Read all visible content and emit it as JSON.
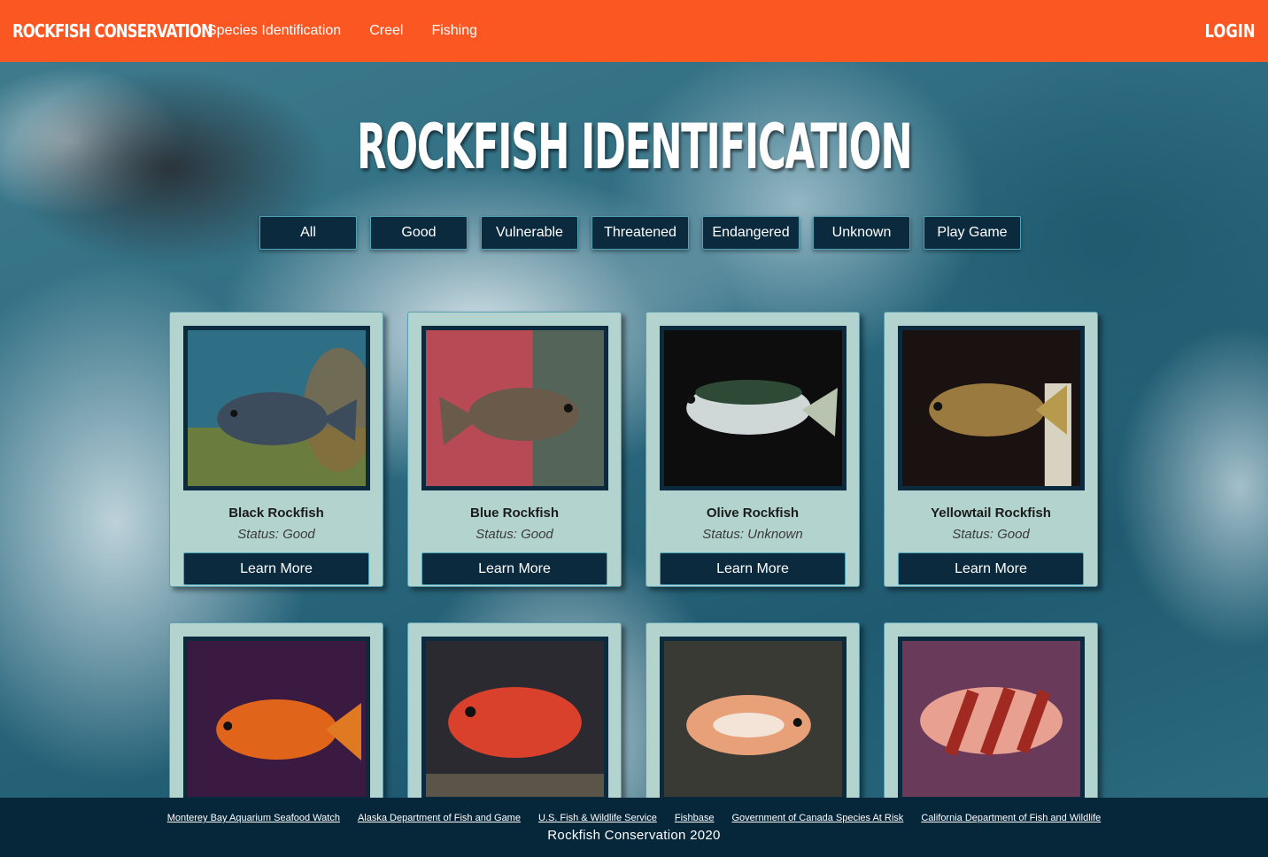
{
  "navbar": {
    "brand": "ROCKFISH CONSERVATION",
    "links": [
      "Species Identification",
      "Creel",
      "Fishing"
    ],
    "login": "LOGIN"
  },
  "page_title": "ROCKFISH IDENTIFICATION",
  "filters": [
    "All",
    "Good",
    "Vulnerable",
    "Threatened",
    "Endangered",
    "Unknown",
    "Play Game"
  ],
  "cards": [
    {
      "name": "Black Rockfish",
      "status": "Status: Good",
      "button": "Learn More",
      "photo_icon": "black-rockfish-photo"
    },
    {
      "name": "Blue Rockfish",
      "status": "Status: Good",
      "button": "Learn More",
      "photo_icon": "blue-rockfish-photo"
    },
    {
      "name": "Olive Rockfish",
      "status": "Status: Unknown",
      "button": "Learn More",
      "photo_icon": "olive-rockfish-photo"
    },
    {
      "name": "Yellowtail Rockfish",
      "status": "Status: Good",
      "button": "Learn More",
      "photo_icon": "yellowtail-rockfish-photo"
    },
    {
      "photo_icon": "orange-rockfish-photo"
    },
    {
      "photo_icon": "red-rockfish-photo"
    },
    {
      "photo_icon": "spotted-rockfish-photo"
    },
    {
      "photo_icon": "tiger-rockfish-photo"
    }
  ],
  "footer": {
    "links": [
      "Monterey Bay Aquarium Seafood Watch",
      "Alaska Department of Fish and Game",
      "U.S. Fish & Wildlife Service",
      "Fishbase",
      "Government of Canada Species At Risk",
      "California Department of Fish and Wildlife"
    ],
    "copyright": "Rockfish Conservation 2020"
  },
  "colors": {
    "header": "#fa5722",
    "button": "#0b2a3d",
    "card": "#b2d3ce",
    "footer": "#06263a"
  }
}
